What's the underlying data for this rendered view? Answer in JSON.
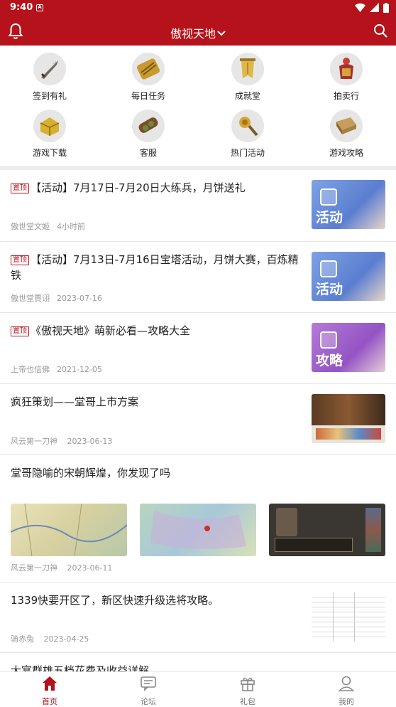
{
  "status_bar": {
    "time": "9:40",
    "notification_letter": "A"
  },
  "header": {
    "title": "傲视天地"
  },
  "grid": [
    {
      "label": "签到有礼",
      "icon": "sword-icon"
    },
    {
      "label": "每日任务",
      "icon": "scroll-icon"
    },
    {
      "label": "成就堂",
      "icon": "banner-icon"
    },
    {
      "label": "拍卖行",
      "icon": "armor-icon"
    },
    {
      "label": "游戏下载",
      "icon": "chest-icon"
    },
    {
      "label": "客服",
      "icon": "bundle-icon"
    },
    {
      "label": "热门活动",
      "icon": "mace-icon"
    },
    {
      "label": "游戏攻略",
      "icon": "book-icon"
    }
  ],
  "feed": [
    {
      "pinned": true,
      "pin_label": "置顶",
      "title": "【活动】7月17日-7月20日大练兵，月饼送礼",
      "author": "傲世堂文姬",
      "time": "4小时前",
      "thumb_word": "活动",
      "thumb_color": "#6b8fd6"
    },
    {
      "pinned": true,
      "pin_label": "置顶",
      "title": "【活动】7月13日-7月16日宝塔活动，月饼大赛，百炼精铁",
      "author": "傲世堂賈诩",
      "time": "2023-07-16",
      "thumb_word": "活动",
      "thumb_color": "#6b8fd6"
    },
    {
      "pinned": true,
      "pin_label": "置顶",
      "title": "《傲视天地》萌新必看—攻略大全",
      "author": "上帝也信佛",
      "time": "2021-12-05",
      "thumb_word": "攻略",
      "thumb_color": "#a462c9"
    },
    {
      "pinned": false,
      "title": "疯狂策划——堂哥上市方案",
      "author": "风云第一刀神",
      "time": "2023-06-13"
    },
    {
      "pinned": false,
      "title": "堂哥隐喻的宋朝辉煌，你发现了吗",
      "author": "风云第一刀神",
      "time": "2023-06-11"
    },
    {
      "pinned": false,
      "title": "1339快要开区了，新区快速升级选将攻略。",
      "author": "骑赤兔",
      "time": "2023-04-25"
    },
    {
      "pinned": false,
      "title": "大宴群雄五档花费及收益详解"
    }
  ],
  "tabbar": [
    {
      "label": "首页",
      "icon": "home-icon",
      "active": true
    },
    {
      "label": "论坛",
      "icon": "forum-icon",
      "active": false
    },
    {
      "label": "礼包",
      "icon": "gift-icon",
      "active": false
    },
    {
      "label": "我的",
      "icon": "profile-icon",
      "active": false
    }
  ],
  "colors": {
    "brand": "#b5121b",
    "meta_text": "#9a9a9a"
  }
}
